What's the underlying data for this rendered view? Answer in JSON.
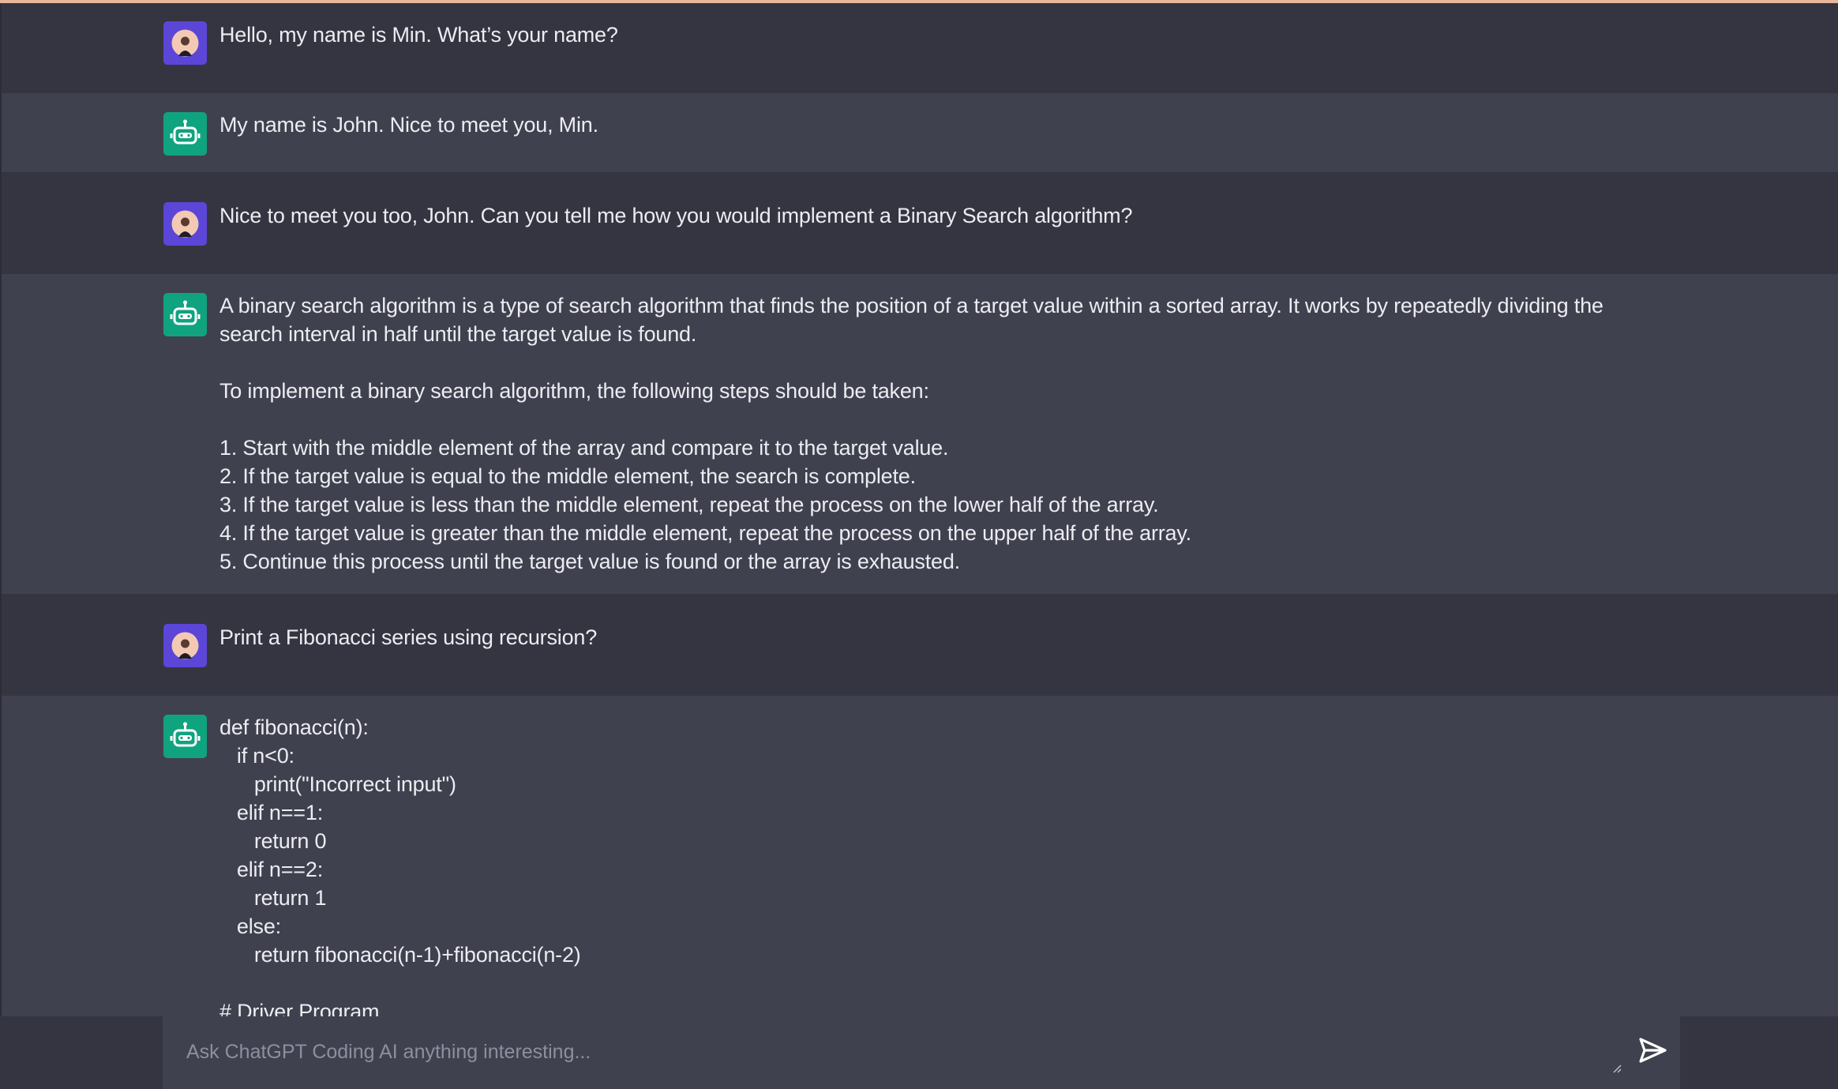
{
  "conversation": {
    "messages": [
      {
        "role": "user",
        "avatar_icon": "user-avatar-icon",
        "text": "Hello, my name is Min. What’s your name?"
      },
      {
        "role": "bot",
        "avatar_icon": "bot-avatar-icon",
        "text": "My name is John. Nice to meet you, Min."
      },
      {
        "role": "user",
        "avatar_icon": "user-avatar-icon",
        "text": "Nice to meet you too, John. Can you tell me how you would implement a Binary Search algorithm?"
      },
      {
        "role": "bot",
        "avatar_icon": "bot-avatar-icon",
        "text": "A binary search algorithm is a type of search algorithm that finds the position of a target value within a sorted array. It works by repeatedly dividing the search interval in half until the target value is found.\n\nTo implement a binary search algorithm, the following steps should be taken:\n\n1. Start with the middle element of the array and compare it to the target value.\n2. If the target value is equal to the middle element, the search is complete.\n3. If the target value is less than the middle element, repeat the process on the lower half of the array.\n4. If the target value is greater than the middle element, repeat the process on the upper half of the array.\n5. Continue this process until the target value is found or the array is exhausted."
      },
      {
        "role": "user",
        "avatar_icon": "user-avatar-icon",
        "text": "Print a Fibonacci series using recursion?"
      },
      {
        "role": "bot",
        "avatar_icon": "bot-avatar-icon",
        "text": "def fibonacci(n):\n   if n<0:\n      print(\"Incorrect input\")\n   elif n==1:\n      return 0\n   elif n==2:\n      return 1\n   else:\n      return fibonacci(n-1)+fibonacci(n-2)\n\n# Driver Program"
      }
    ]
  },
  "composer": {
    "placeholder": "Ask ChatGPT Coding AI anything interesting...",
    "value": "",
    "send_icon": "send-icon"
  },
  "colors": {
    "user_row_bg": "#343541",
    "bot_row_bg": "#40414f",
    "user_avatar_bg": "#5c46d8",
    "bot_avatar_bg": "#10a37f",
    "text": "#ececf1",
    "placeholder": "#8e8ea0"
  }
}
